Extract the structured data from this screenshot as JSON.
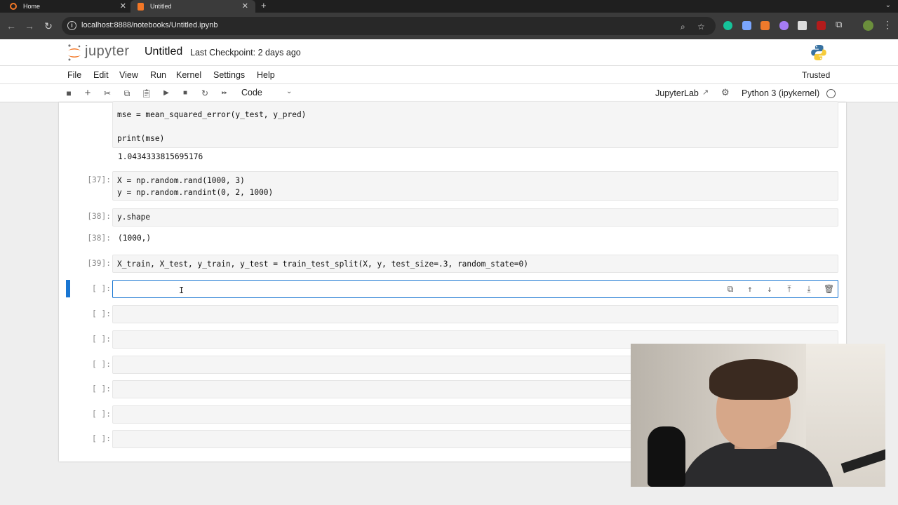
{
  "browser": {
    "tabs": [
      {
        "label": "Home",
        "active": false
      },
      {
        "label": "Untitled",
        "active": true
      }
    ],
    "url": "localhost:8888/notebooks/Untitled.ipynb"
  },
  "header": {
    "logo_text": "jupyter",
    "notebook_title": "Untitled",
    "checkpoint": "Last Checkpoint: 2 days ago"
  },
  "menu": {
    "items": [
      "File",
      "Edit",
      "View",
      "Run",
      "Kernel",
      "Settings",
      "Help"
    ],
    "trusted": "Trusted"
  },
  "toolbar": {
    "cell_type": "Code",
    "jupyterlab_link": "JupyterLab",
    "kernel": "Python 3 (ipykernel)"
  },
  "cells": [
    {
      "prompt": "",
      "code": [
        "mse = mean_squared_error(y_test, y_pred)",
        "",
        "print(mse)"
      ],
      "output": "1.0434333815695176"
    },
    {
      "prompt": "[37]:",
      "code": [
        "X = np.random.rand(1000, 3)",
        "y = np.random.randint(0, 2, 1000)"
      ]
    },
    {
      "prompt": "[38]:",
      "code": [
        "y.shape"
      ],
      "output_prompt": "[38]:",
      "output": "(1000,)"
    },
    {
      "prompt": "[39]:",
      "code": [
        "X_train, X_test, y_train, y_test = train_test_split(X, y, test_size=.3, random_state=0)"
      ]
    },
    {
      "prompt": "[ ]:",
      "code": [],
      "active": true
    },
    {
      "prompt": "[ ]:",
      "code": []
    },
    {
      "prompt": "[ ]:",
      "code": []
    },
    {
      "prompt": "[ ]:",
      "code": []
    },
    {
      "prompt": "[ ]:",
      "code": []
    },
    {
      "prompt": "[ ]:",
      "code": []
    },
    {
      "prompt": "[ ]:",
      "code": []
    }
  ],
  "colors": {
    "accent": "#1976d2",
    "keyword": "#aa22ff",
    "number": "#008000"
  }
}
